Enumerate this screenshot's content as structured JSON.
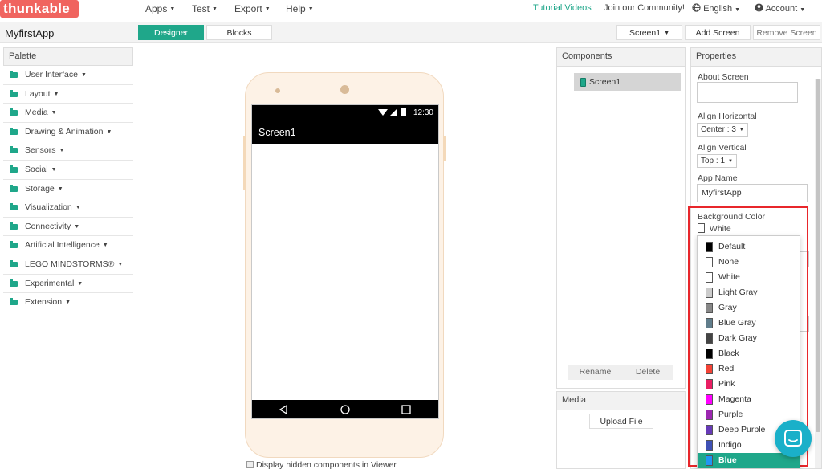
{
  "topnav": {
    "logo": "thunkable",
    "menus": [
      "Apps",
      "Test",
      "Export",
      "Help"
    ],
    "tutorial": "Tutorial Videos",
    "community": "Join our Community!",
    "language": "English",
    "account": "Account"
  },
  "toolbar": {
    "project_name": "MyfirstApp",
    "designer": "Designer",
    "blocks": "Blocks",
    "screen_select": "Screen1",
    "add_screen": "Add Screen",
    "remove_screen": "Remove Screen"
  },
  "palette": {
    "header": "Palette",
    "items": [
      "User Interface",
      "Layout",
      "Media",
      "Drawing & Animation",
      "Sensors",
      "Social",
      "Storage",
      "Visualization",
      "Connectivity",
      "Artificial Intelligence",
      "LEGO MINDSTORMS®",
      "Experimental",
      "Extension"
    ]
  },
  "viewer": {
    "status_time": "12:30",
    "screen_title": "Screen1",
    "display_hidden": "Display hidden components in Viewer"
  },
  "components": {
    "header": "Components",
    "tree_item": "Screen1",
    "rename": "Rename",
    "delete": "Delete"
  },
  "media": {
    "header": "Media",
    "upload": "Upload File"
  },
  "properties": {
    "header": "Properties",
    "about_screen": "About Screen",
    "align_horizontal": "Align Horizontal",
    "align_horizontal_value": "Center : 3",
    "align_vertical": "Align Vertical",
    "align_vertical_value": "Top : 1",
    "app_name": "App Name",
    "app_name_value": "MyfirstApp",
    "background_color": "Background Color",
    "background_color_value": "White"
  },
  "color_dropdown": {
    "options": [
      {
        "label": "Default",
        "color": "#000000"
      },
      {
        "label": "None",
        "color": "#ffffff"
      },
      {
        "label": "White",
        "color": "#ffffff"
      },
      {
        "label": "Light Gray",
        "color": "#cccccc"
      },
      {
        "label": "Gray",
        "color": "#888888"
      },
      {
        "label": "Blue Gray",
        "color": "#607d8b"
      },
      {
        "label": "Dark Gray",
        "color": "#444444"
      },
      {
        "label": "Black",
        "color": "#000000"
      },
      {
        "label": "Red",
        "color": "#f44336"
      },
      {
        "label": "Pink",
        "color": "#e91e63"
      },
      {
        "label": "Magenta",
        "color": "#ff00ff"
      },
      {
        "label": "Purple",
        "color": "#9c27b0"
      },
      {
        "label": "Deep Purple",
        "color": "#673ab7"
      },
      {
        "label": "Indigo",
        "color": "#3f51b5"
      },
      {
        "label": "Blue",
        "color": "#2196f3"
      }
    ],
    "selected": "Blue"
  },
  "colors": {
    "accent": "#1fa78a",
    "logo_bg": "#f0645f",
    "highlight_border": "#e8262b",
    "chat_bubble": "#1ab0c9"
  }
}
